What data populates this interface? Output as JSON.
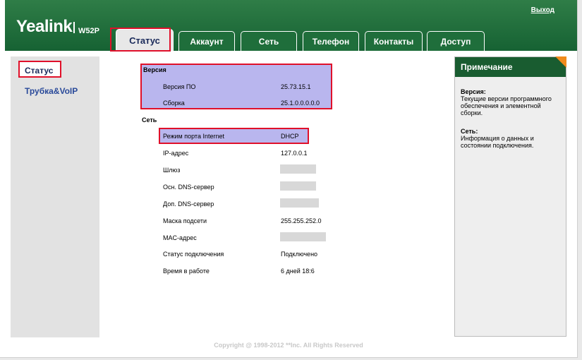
{
  "brand": {
    "name": "Yealink",
    "model": "W52P"
  },
  "header": {
    "logout_label": "Выход"
  },
  "tabs": [
    {
      "label": "Статус",
      "active": true
    },
    {
      "label": "Аккаунт",
      "active": false
    },
    {
      "label": "Сеть",
      "active": false
    },
    {
      "label": "Телефон",
      "active": false
    },
    {
      "label": "Контакты",
      "active": false
    },
    {
      "label": "Доступ",
      "active": false
    }
  ],
  "sidebar": {
    "items": [
      {
        "label": "Статус",
        "selected": true
      },
      {
        "label": "Трубка&VoIP",
        "selected": false
      }
    ]
  },
  "version": {
    "section_title": "Версия",
    "rows": [
      {
        "label": "Версия ПО",
        "value": "25.73.15.1"
      },
      {
        "label": "Сборка",
        "value": "25.1.0.0.0.0.0"
      }
    ]
  },
  "network": {
    "section_title": "Сеть",
    "rows": [
      {
        "label": "Режим порта Internet",
        "value": "DHCP"
      },
      {
        "label": "IP-адрес",
        "value": "127.0.0.1"
      },
      {
        "label": "Шлюз",
        "value": ""
      },
      {
        "label": "Осн. DNS-сервер",
        "value": ""
      },
      {
        "label": "Доп. DNS-сервер",
        "value": ""
      },
      {
        "label": "Маска подсети",
        "value": "255.255.252.0"
      },
      {
        "label": "MAC-адрес",
        "value": ""
      },
      {
        "label": "Статус подключения",
        "value": "Подключено"
      },
      {
        "label": "Время в работе",
        "value": "6 дней 18:6"
      }
    ]
  },
  "note": {
    "title": "Примечание",
    "entries": [
      {
        "heading": "Версия:",
        "text": "Текущие версии программного обеспечения и элементной сборки."
      },
      {
        "heading": "Сеть:",
        "text": "Информация о данных и состоянии подключения."
      }
    ]
  },
  "footer": {
    "copyright": "Copyright @ 1998-2012 **Inc. All Rights Reserved"
  },
  "colors": {
    "header_green": "#1a6a36",
    "highlight_purple": "#b9b6ee",
    "annotation_red": "#e0102a",
    "note_accent": "#f08a1c"
  }
}
